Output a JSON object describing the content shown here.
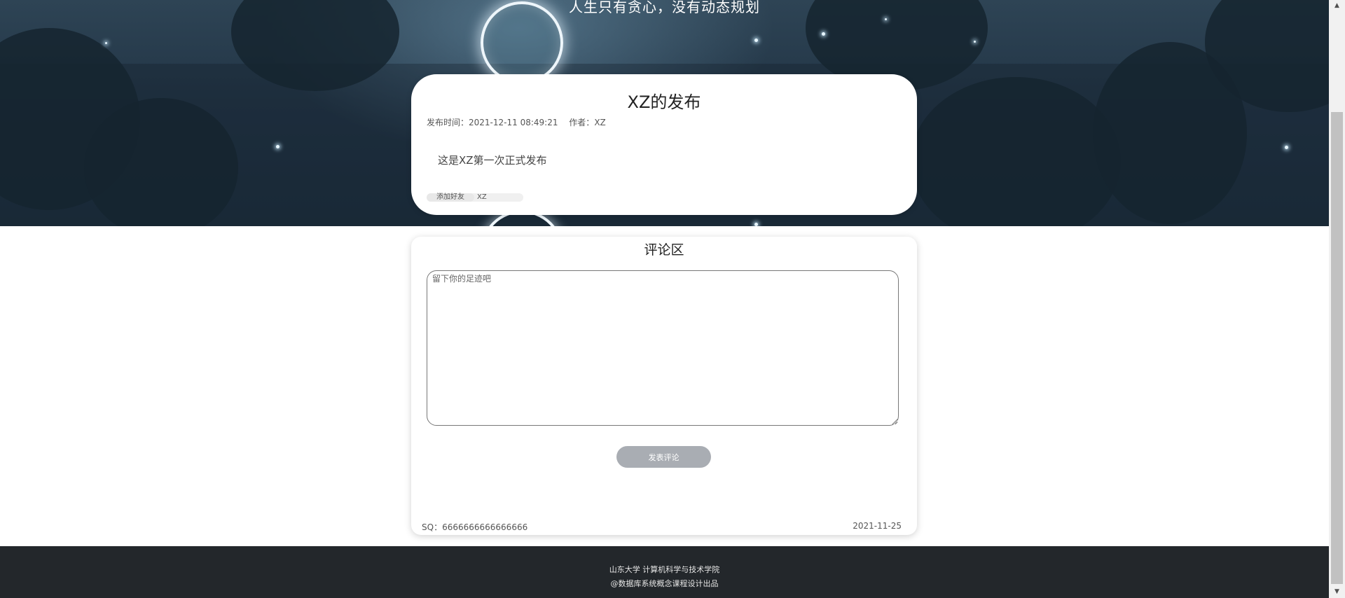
{
  "hero": {
    "motto": "人生只有贪心，没有动态规划"
  },
  "post": {
    "title": "XZ的发布",
    "publish_time_label": "发布时间：",
    "publish_time": "2021-12-11 08:49:21",
    "author_label": "作者：",
    "author": "XZ",
    "content": "这是XZ第一次正式发布",
    "add_friend_label": "添加好友",
    "friend_name": "XZ"
  },
  "comments": {
    "title": "评论区",
    "placeholder": "留下你的足迹吧",
    "submit_label": "发表评论",
    "footer_left": "SQ：6666666666666666",
    "footer_right": "2021-11-25"
  },
  "footer": {
    "line1": "山东大学 计算机科学与技术学院",
    "line2": "@数据库系统概念课程设计出品"
  },
  "colors": {
    "hero_bg": "#223546",
    "footer_bg": "#23272b",
    "button_bg": "#a9adb3"
  },
  "icons": {
    "scroll_up": "triangle-up-icon",
    "scroll_down": "triangle-down-icon"
  }
}
